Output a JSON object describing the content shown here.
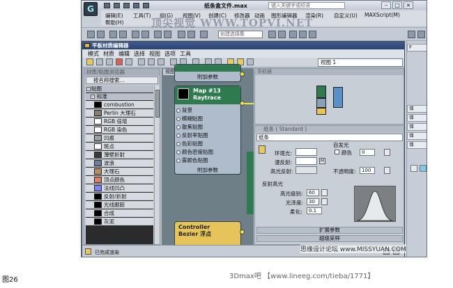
{
  "outer": {
    "logo": "G",
    "title": "纸条盒文件.max",
    "search_placeholder": "键入关键字或短语",
    "menus": [
      "编辑(E)",
      "工具(T)",
      "组(G)",
      "视图(V)",
      "创建(C)",
      "修改器",
      "动画",
      "图形编辑器",
      "渲染(R)",
      "自定义(U)",
      "MAXScript(M)",
      "帮助(H)"
    ],
    "selection_set_placeholder": "创建选择集",
    "watermark": "顶尖视觉 WWW.TOPVI.NET",
    "right_tabs": [
      "F",
      "体",
      "体",
      "体",
      "体",
      "体"
    ]
  },
  "slate": {
    "title": "平板材质编辑器",
    "menus": [
      "模式",
      "材质",
      "编辑",
      "选择",
      "视图",
      "选项",
      "工具"
    ],
    "view_select": "视图 1",
    "browser_title": "材质/贴图浏览器",
    "browser_search": "按名称搜索...",
    "categories": [
      {
        "label": "贴图",
        "sign": "-"
      },
      {
        "label": "标准",
        "sign": "-"
      }
    ],
    "maps": [
      {
        "label": "combustion",
        "thumb": "#000000"
      },
      {
        "label": "Perlin 大理石",
        "thumb": "#8a7d6a"
      },
      {
        "label": "RGB 倍增",
        "thumb": "#ffffff"
      },
      {
        "label": "RGB 染色",
        "thumb": "#ffffff"
      },
      {
        "label": "凹痕",
        "thumb": "#9aa0a8"
      },
      {
        "label": "斑点",
        "thumb": "#ffffff"
      },
      {
        "label": "薄壁折射",
        "thumb": "#3a3a3a"
      },
      {
        "label": "波浪",
        "thumb": "#6e7f9a"
      },
      {
        "label": "大理石",
        "thumb": "#b49060"
      },
      {
        "label": "顶点颜色",
        "thumb": "#e08060"
      },
      {
        "label": "法线凹凸",
        "thumb": "#8080ff"
      },
      {
        "label": "反射/折射",
        "thumb": "#000000"
      },
      {
        "label": "光线跟踪",
        "thumb": "#000000"
      },
      {
        "label": "合成",
        "thumb": "#000000"
      },
      {
        "label": "灰泥",
        "thumb": "#000000"
      }
    ],
    "view_tab": "视图 1",
    "node_top_footer": "附加参数",
    "map13": {
      "title": "Map #13",
      "subtitle": "Raytrace",
      "slots": [
        "背景",
        "模糊贴图",
        "散焦贴图",
        "反射率贴图",
        "色彩贴图",
        "颜色密度贴图",
        "雾颜色贴图"
      ],
      "footer": "附加参数"
    },
    "controller": {
      "title": "Controller",
      "subtitle": "Bezier 浮点"
    },
    "navigator_title": "导航器",
    "params": {
      "title": "纸条 ( Standard )",
      "name": "纸条",
      "ambient": "环境光:",
      "diffuse": "漫反射:",
      "specular": "高光反射:",
      "selfillum": "自发光",
      "color": "颜色",
      "color_value": "0",
      "opacity": "不透明度:",
      "opacity_value": "100",
      "m_button": "M",
      "highlight_group": "反射高光",
      "spec_level": "高光级别:",
      "spec_level_value": "60",
      "gloss": "光泽度:",
      "gloss_value": "30",
      "soften": "柔化:",
      "soften_value": "0.1",
      "rollout1": "扩展参数",
      "rollout2": "超级采样"
    },
    "status": "已完成渲染"
  },
  "site_mark": "思缘设计论坛 www.MISSYUAN.COM",
  "fig_label": "图26",
  "footer": "3Dmax吧 【www.lineeg.com/tieba/1771】",
  "colors": {
    "node_green": "#2f7a4f",
    "node_gold": "#e6c45a",
    "wire": "#f1e34c",
    "title_blue": "#2b4470"
  }
}
